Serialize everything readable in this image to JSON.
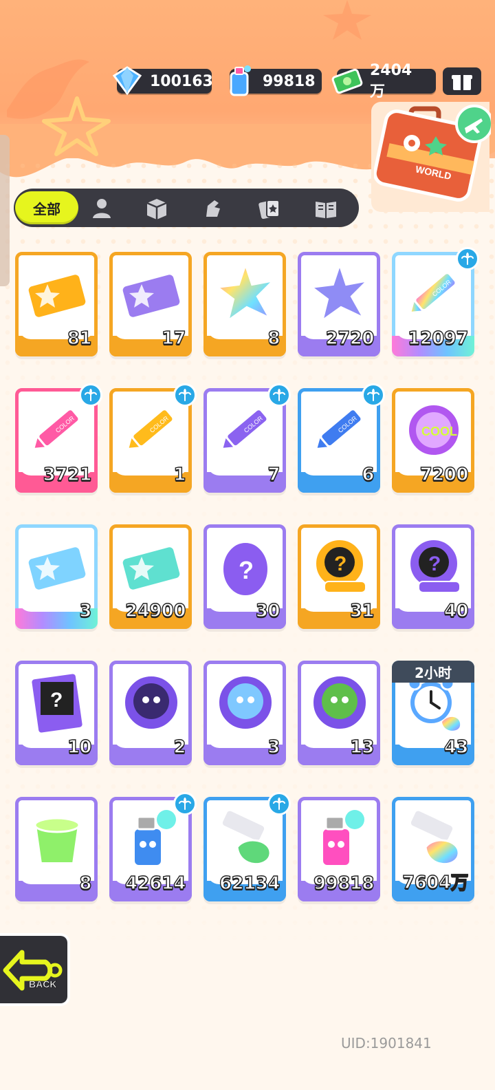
{
  "currency": [
    {
      "name": "gem",
      "value": "100163",
      "color": "#4fb3ff"
    },
    {
      "name": "spray-can",
      "value": "99818",
      "color": "#49a8ff"
    },
    {
      "name": "cash",
      "value": "2404万",
      "color": "#3fc35a"
    }
  ],
  "tabs": {
    "active_label": "全部",
    "icons": [
      "person-icon",
      "box-icon",
      "hand-icon",
      "cards-icon",
      "book-icon"
    ]
  },
  "items": [
    {
      "icon": "gold-ticket-icon",
      "count": "81",
      "rarity": "orange",
      "palm": false
    },
    {
      "icon": "purple-ticket-icon",
      "count": "17",
      "rarity": "orange",
      "palm": false
    },
    {
      "icon": "rainbow-star-icon",
      "count": "8",
      "rarity": "orange",
      "palm": false
    },
    {
      "icon": "purple-star-icon",
      "count": "2720",
      "rarity": "purple",
      "palm": false
    },
    {
      "icon": "rainbow-crayon-icon",
      "count": "12097",
      "rarity": "rainbow",
      "palm": true
    },
    {
      "icon": "pink-crayon-icon",
      "count": "3721",
      "rarity": "pink",
      "palm": true
    },
    {
      "icon": "yellow-crayon-icon",
      "count": "1",
      "rarity": "orange",
      "palm": true
    },
    {
      "icon": "purple-crayon-icon",
      "count": "7",
      "rarity": "purple",
      "palm": true
    },
    {
      "icon": "blue-crayon-icon",
      "count": "6",
      "rarity": "blue",
      "palm": true
    },
    {
      "icon": "cool-badge-icon",
      "count": "7200",
      "rarity": "orange",
      "palm": false
    },
    {
      "icon": "rainbow-lottery-ticket-icon",
      "count": "3",
      "rarity": "rainbow",
      "palm": false
    },
    {
      "icon": "season-ticket-icon",
      "count": "24900",
      "rarity": "orange",
      "palm": false
    },
    {
      "icon": "mystery-egg-icon",
      "count": "30",
      "rarity": "purple",
      "palm": false
    },
    {
      "icon": "gold-mystery-deity-icon",
      "count": "31",
      "rarity": "orange",
      "palm": false
    },
    {
      "icon": "purple-mystery-deity-icon",
      "count": "40",
      "rarity": "purple",
      "palm": false
    },
    {
      "icon": "mystery-travel-card-icon",
      "count": "10",
      "rarity": "purple",
      "palm": false
    },
    {
      "icon": "cat-mpets-icon",
      "count": "2",
      "rarity": "purple",
      "palm": false
    },
    {
      "icon": "fish-mpets-icon",
      "count": "3",
      "rarity": "purple",
      "palm": false
    },
    {
      "icon": "plant-mpets-icon",
      "count": "13",
      "rarity": "purple",
      "palm": false
    },
    {
      "icon": "alarm-clock-icon",
      "count": "43",
      "rarity": "blue",
      "palm": false,
      "timer": "2小时"
    },
    {
      "icon": "green-jelly-cup-icon",
      "count": "8",
      "rarity": "purple",
      "palm": false
    },
    {
      "icon": "blue-spray-can-icon",
      "count": "42614",
      "rarity": "purple",
      "palm": true
    },
    {
      "icon": "paint-tube-icon",
      "count": "62134",
      "rarity": "blue",
      "palm": true
    },
    {
      "icon": "pink-spray-can-icon",
      "count": "99818",
      "rarity": "purple",
      "palm": false
    },
    {
      "icon": "rainbow-paint-tube-icon",
      "count": "7604万",
      "rarity": "blue",
      "palm": false
    }
  ],
  "back_label": "BACK",
  "suitcase_label": "WORLD",
  "uid": "UID:1901841"
}
